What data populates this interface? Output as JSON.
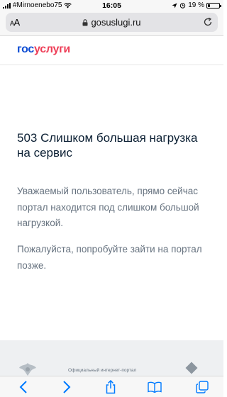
{
  "status_bar": {
    "carrier": "#Mirnoenebo75",
    "time": "16:05",
    "battery_percent_text": "19 %",
    "battery_level": 0.19
  },
  "browser": {
    "text_size_label_small": "A",
    "text_size_label_large": "A",
    "url": "gosuslugi.ru"
  },
  "site": {
    "logo_part1": "гос",
    "logo_part2": "услуги",
    "brand_blue": "#0d4cd3",
    "brand_red": "#ee3f58"
  },
  "main": {
    "title": "503 Слишком большая нагрузка на сервис",
    "paragraph1": "Уважаемый пользователь, прямо сейчас портал находится под слишком большой нагрузкой.",
    "paragraph2": "Пожалуйста, попробуйте зайти на портал позже."
  },
  "footer": {
    "text": "Официальный интернет-портал"
  },
  "toolbar": {
    "icons": [
      "back-icon",
      "forward-icon",
      "share-icon",
      "bookmarks-icon",
      "tabs-icon"
    ]
  }
}
